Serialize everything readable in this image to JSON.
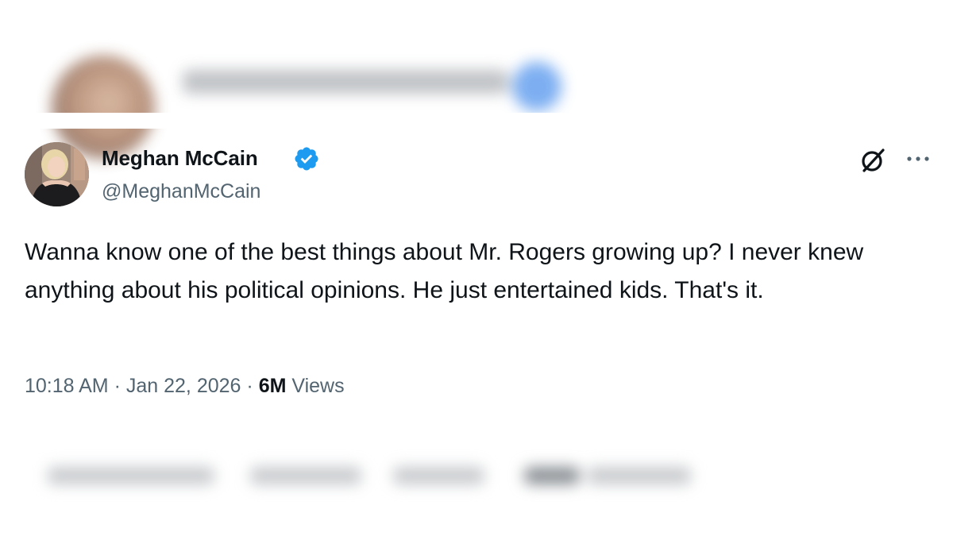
{
  "tweet": {
    "author_name": "Meghan McCain",
    "handle": "@MeghanMcCain",
    "text": "Wanna know one of the best things about Mr. Rogers growing up? I never knew anything about his political opinions. He just entertained kids. That's it.",
    "time": "10:18 AM",
    "separator": "·",
    "date": "Jan 22, 2026",
    "views_count": "6M",
    "views_label": "Views"
  },
  "icons": {
    "verified": "verified-badge-icon",
    "grok": "grok-icon",
    "more": "more-options-icon"
  },
  "colors": {
    "verified_blue": "#1d9bf0",
    "text_primary": "#0f1419",
    "text_secondary": "#536471"
  }
}
